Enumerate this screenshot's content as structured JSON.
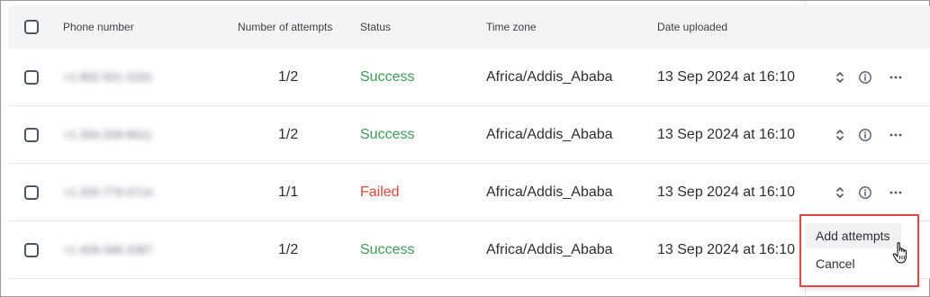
{
  "table": {
    "columns": {
      "phone": "Phone number",
      "attempts": "Number of attempts",
      "status": "Status",
      "timezone": "Time zone",
      "date": "Date uploaded"
    },
    "rows": [
      {
        "phone": "+1 802-501-3191",
        "attempts": "1/2",
        "status": "Success",
        "timezone": "Africa/Addis_Ababa",
        "date": "13 Sep 2024 at 16:10"
      },
      {
        "phone": "+1 334-209-8611",
        "attempts": "1/2",
        "status": "Success",
        "timezone": "Africa/Addis_Ababa",
        "date": "13 Sep 2024 at 16:10"
      },
      {
        "phone": "+1 205-779-0714",
        "attempts": "1/1",
        "status": "Failed",
        "timezone": "Africa/Addis_Ababa",
        "date": "13 Sep 2024 at 16:10"
      },
      {
        "phone": "+1 409-346-2387",
        "attempts": "1/2",
        "status": "Success",
        "timezone": "Africa/Addis_Ababa",
        "date": "13 Sep 2024 at 16:10"
      }
    ]
  },
  "menu": {
    "add_attempts": "Add attempts",
    "cancel": "Cancel"
  },
  "icons": {
    "reorder": "chevron-up-down-icon",
    "info": "info-icon",
    "more": "more-horizontal-icon",
    "cursor": "hand-pointer-icon"
  },
  "colors": {
    "success": "#3a9b54",
    "failed": "#e0453a",
    "highlight_border": "#e04848"
  }
}
